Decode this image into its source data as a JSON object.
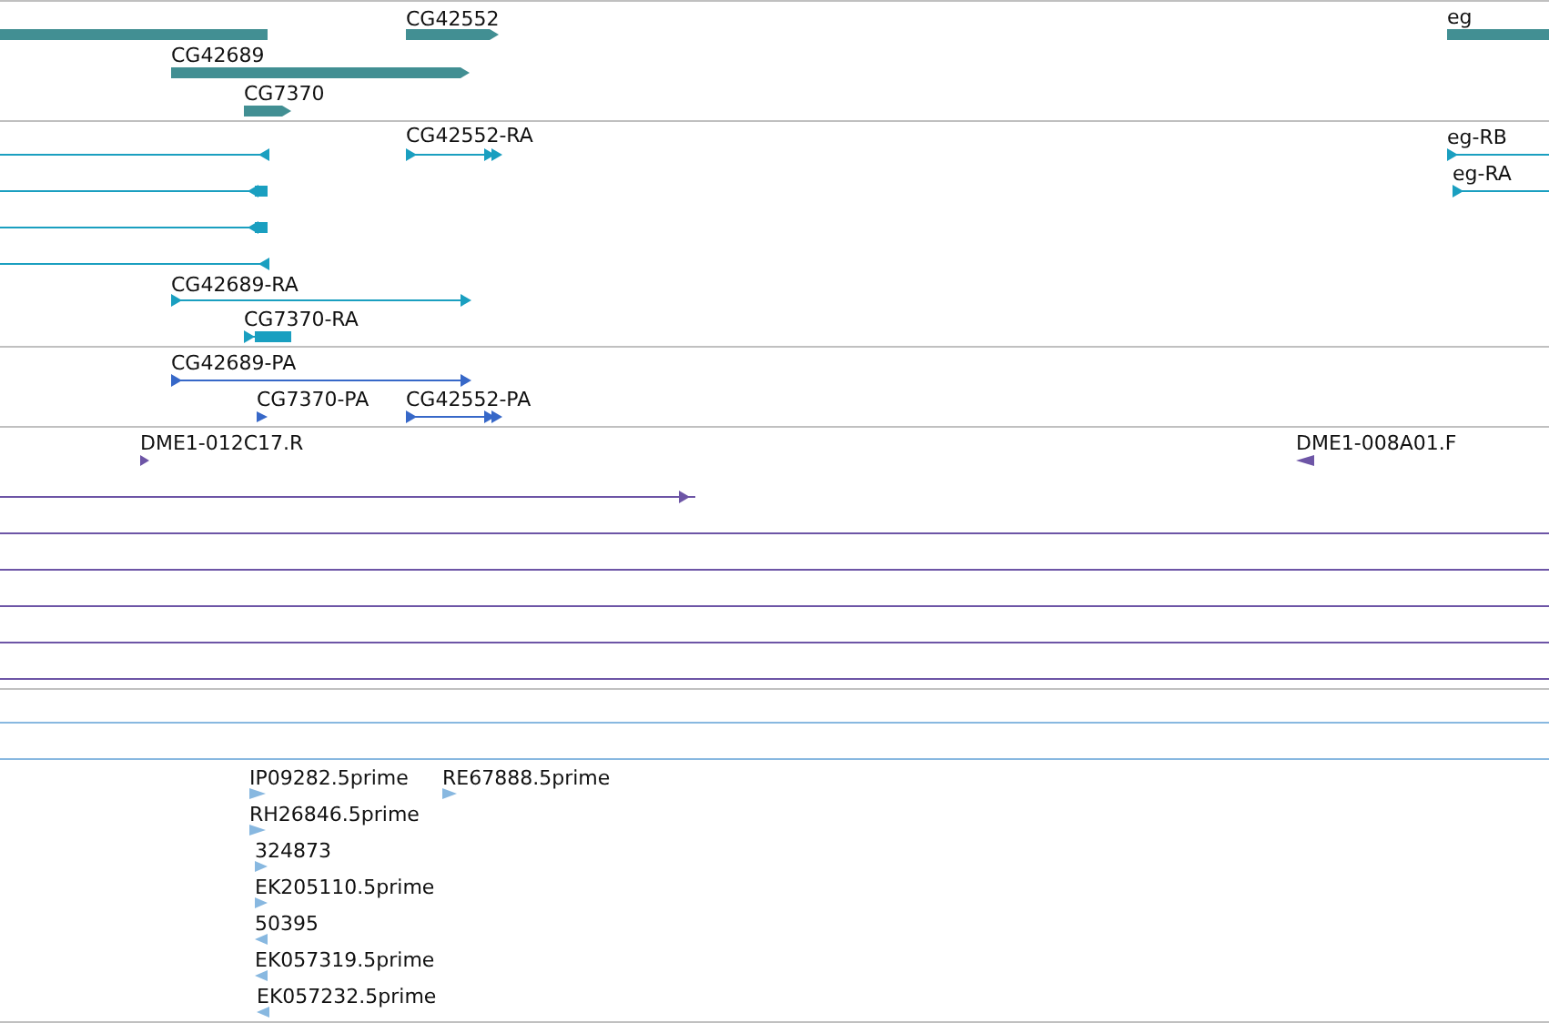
{
  "tracks": [
    {
      "kind": "gene",
      "features": [
        {
          "kind": "bar"
        },
        {
          "kind": "bar",
          "reverse": false,
          "label": "CG42552"
        },
        {
          "kind": "bar",
          "label": "eg"
        },
        {
          "kind": "bar",
          "reverse": false,
          "label": "CG42689"
        },
        {
          "kind": "bar",
          "reverse": false,
          "label": "CG7370"
        }
      ]
    },
    {
      "kind": "transcript",
      "features": [
        {
          "kind": "line",
          "reverse": true
        },
        {
          "kind": "line",
          "reverse": false,
          "label": "CG42552-RA"
        },
        {
          "kind": "line",
          "reverse": false,
          "label": "eg-RB"
        },
        {
          "kind": "line",
          "reverse": false,
          "label": "eg-RA"
        },
        {
          "kind": "line",
          "reverse": true
        },
        {
          "kind": "line",
          "reverse": true
        },
        {
          "kind": "line",
          "reverse": true
        },
        {
          "kind": "line",
          "reverse": false,
          "label": "CG42689-RA"
        },
        {
          "kind": "line",
          "reverse": false,
          "label": "CG7370-RA"
        }
      ]
    },
    {
      "kind": "protein",
      "features": [
        {
          "kind": "line",
          "reverse": false,
          "label": "CG42689-PA"
        },
        {
          "kind": "arrow",
          "reverse": false,
          "label": "CG7370-PA"
        },
        {
          "kind": "line",
          "reverse": false,
          "label": "CG42552-PA"
        }
      ]
    },
    {
      "kind": "clone",
      "features": [
        {
          "kind": "arrow",
          "reverse": false,
          "label": "DME1-012C17.R"
        },
        {
          "kind": "arrow",
          "reverse": true,
          "label": "DME1-008A01.F"
        },
        {
          "kind": "line",
          "reverse": false
        },
        {
          "kind": "line"
        },
        {
          "kind": "line"
        },
        {
          "kind": "line"
        },
        {
          "kind": "line"
        },
        {
          "kind": "line"
        }
      ]
    },
    {
      "kind": "est",
      "features": [
        {
          "kind": "line"
        },
        {
          "kind": "line"
        },
        {
          "kind": "arrow",
          "reverse": false,
          "label": "IP09282.5prime"
        },
        {
          "kind": "arrow",
          "reverse": false,
          "label": "RE67888.5prime"
        },
        {
          "kind": "arrow",
          "reverse": false,
          "label": "RH26846.5prime"
        },
        {
          "kind": "arrow",
          "reverse": false,
          "label": "324873"
        },
        {
          "kind": "arrow",
          "reverse": false,
          "label": "EK205110.5prime"
        },
        {
          "kind": "arrow",
          "reverse": true,
          "label": "50395"
        },
        {
          "kind": "arrow",
          "reverse": true,
          "label": "EK057319.5prime"
        },
        {
          "kind": "arrow",
          "reverse": true,
          "label": "EK057232.5prime"
        }
      ]
    }
  ]
}
